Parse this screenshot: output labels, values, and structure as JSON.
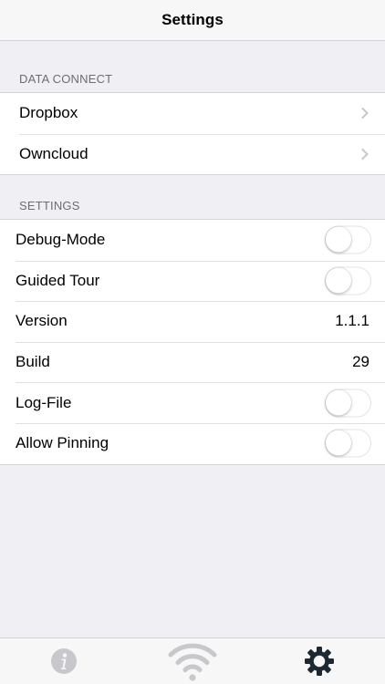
{
  "navbar": {
    "title": "Settings"
  },
  "sections": {
    "data_connect": {
      "header": "DATA CONNECT",
      "items": [
        {
          "label": "Dropbox"
        },
        {
          "label": "Owncloud"
        }
      ]
    },
    "settings": {
      "header": "SETTINGS",
      "items": [
        {
          "label": "Debug-Mode",
          "toggle_on": false
        },
        {
          "label": "Guided Tour",
          "toggle_on": false
        },
        {
          "label": "Version",
          "value": "1.1.1"
        },
        {
          "label": "Build",
          "value": "29"
        },
        {
          "label": "Log-File",
          "toggle_on": false
        },
        {
          "label": "Allow Pinning",
          "toggle_on": false
        }
      ]
    }
  },
  "tabbar": {
    "tabs": [
      {
        "icon": "info-icon",
        "active": false
      },
      {
        "icon": "wifi-icon",
        "active": false
      },
      {
        "icon": "gear-icon",
        "active": true
      }
    ]
  },
  "colors": {
    "background": "#efeff4",
    "inactive_icon": "#c7c7cc",
    "active_icon": "#1e2833",
    "section_header": "#6d6d72"
  }
}
